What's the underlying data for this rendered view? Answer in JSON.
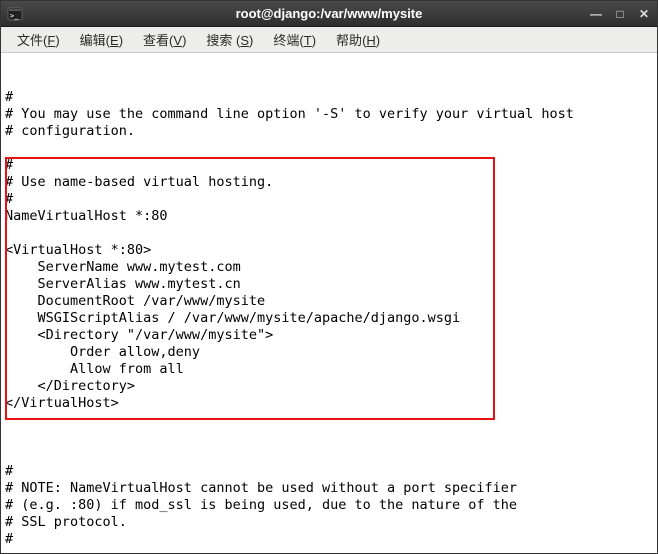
{
  "titlebar": {
    "title": "root@django:/var/www/mysite"
  },
  "menubar": {
    "items": [
      {
        "label": "文件",
        "key": "F"
      },
      {
        "label": "编辑",
        "key": "E"
      },
      {
        "label": "查看",
        "key": "V"
      },
      {
        "label": "搜索",
        "key": "S"
      },
      {
        "label": "终端",
        "key": "T"
      },
      {
        "label": "帮助",
        "key": "H"
      }
    ]
  },
  "terminal": {
    "lines": [
      "#",
      "# You may use the command line option '-S' to verify your virtual host",
      "# configuration.",
      "",
      "#",
      "# Use name-based virtual hosting.",
      "#",
      "NameVirtualHost *:80",
      "",
      "<VirtualHost *:80>",
      "    ServerName www.mytest.com",
      "    ServerAlias www.mytest.cn",
      "    DocumentRoot /var/www/mysite",
      "    WSGIScriptAlias / /var/www/mysite/apache/django.wsgi",
      "    <Directory \"/var/www/mysite\">",
      "        Order allow,deny",
      "        Allow from all",
      "    </Directory>",
      "</VirtualHost>",
      "",
      "",
      "",
      "#",
      "# NOTE: NameVirtualHost cannot be used without a port specifier",
      "# (e.g. :80) if mod_ssl is being used, due to the nature of the",
      "# SSL protocol.",
      "#"
    ]
  }
}
